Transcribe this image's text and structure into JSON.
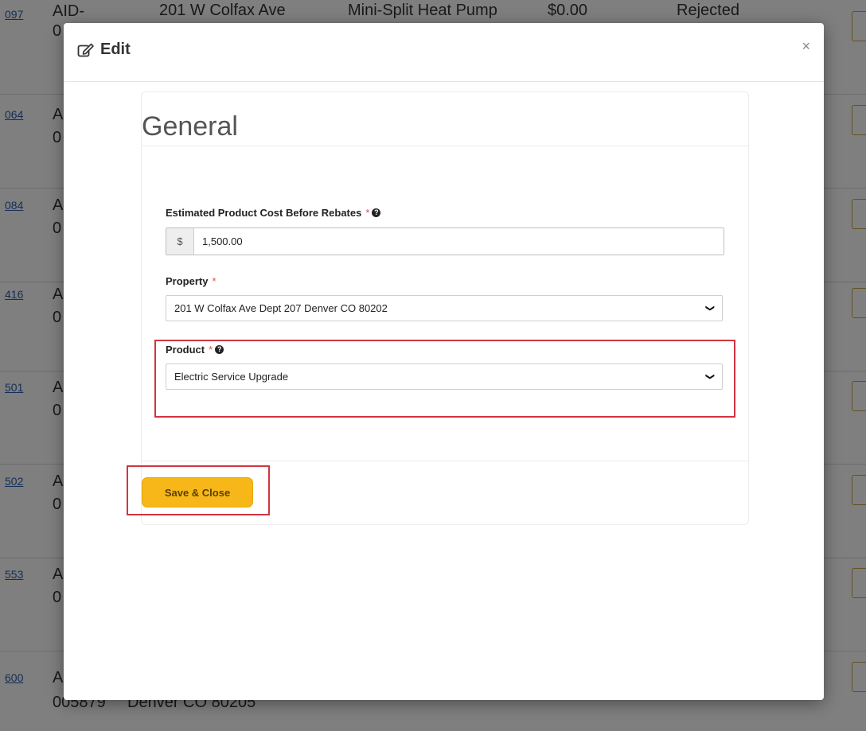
{
  "background_table": {
    "rows": [
      {
        "link": "097",
        "id_line1": "AID-",
        "id_line2": "0",
        "address": "201 W Colfax Ave",
        "product": "Mini-Split Heat Pump",
        "amount": "$0.00",
        "status": "Rejected"
      },
      {
        "link": "064",
        "id_line1": "A",
        "id_line2": "0"
      },
      {
        "link": "084",
        "id_line1": "A",
        "id_line2": "0"
      },
      {
        "link": "416",
        "id_line1": "A",
        "id_line2": "0"
      },
      {
        "link": "501",
        "id_line1": "A",
        "id_line2": "0"
      },
      {
        "link": "502",
        "id_line1": "A",
        "id_line2": "0"
      },
      {
        "link": "553",
        "id_line1": "A",
        "id_line2": "0"
      },
      {
        "link": "600",
        "id_line1": "A",
        "id_line2": "005879",
        "address": "Denver CO 80205"
      }
    ]
  },
  "modal": {
    "title": "Edit",
    "title_icon": "edit-icon",
    "close_label": "×"
  },
  "section": {
    "title": "General"
  },
  "fields": {
    "cost": {
      "label": "Estimated Product Cost Before Rebates",
      "required_mark": "*",
      "currency": "$",
      "value": "1,500.00"
    },
    "property": {
      "label": "Property",
      "required_mark": "*",
      "value": "201 W Colfax Ave Dept 207 Denver CO 80202"
    },
    "product": {
      "label": "Product",
      "required_mark": "*",
      "value": "Electric Service Upgrade"
    }
  },
  "actions": {
    "save_label": "Save & Close"
  },
  "colors": {
    "accent": "#f7b718",
    "highlight": "#d0353f",
    "required": "#d9534f"
  }
}
